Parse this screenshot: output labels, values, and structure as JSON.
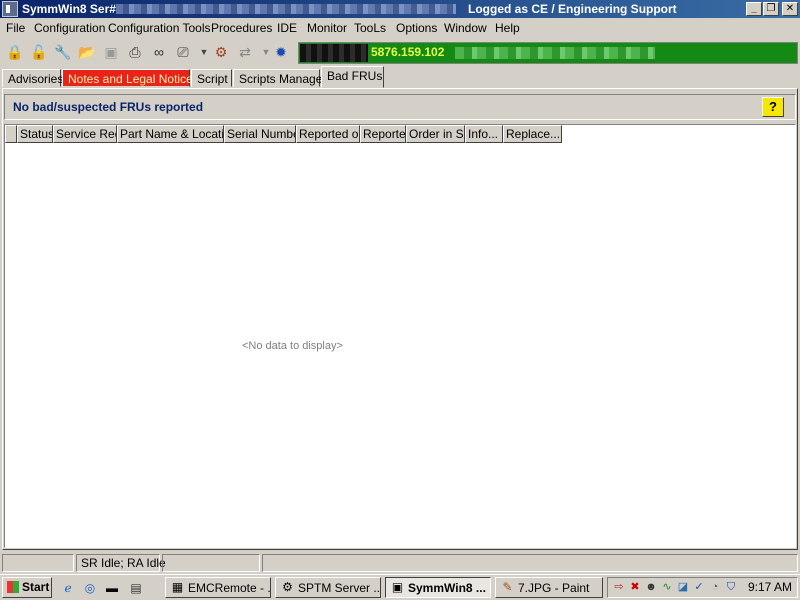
{
  "window": {
    "title": "SymmWin8 Ser#",
    "status": "Logged as CE / Engineering Support",
    "controls": {
      "minimize": "_",
      "restore": "❐",
      "close": "✕"
    }
  },
  "menu": [
    "File",
    "Configuration",
    "Configuration Tools",
    "Procedures",
    "IDE",
    "Monitor",
    "TooLs",
    "Options",
    "Window",
    "Help"
  ],
  "toolbar": {
    "icons": [
      "lock-icon",
      "lock-open-icon",
      "wrench-icon",
      "folder-open-icon",
      "save-icon",
      "print-icon",
      "binoculars-icon",
      "printer-setup-icon",
      "dropdown-arrow-icon",
      "plugin-icon",
      "connect-icon",
      "dropdown-arrow-icon",
      "gear-icon"
    ],
    "host_ip": "5876.159.102"
  },
  "tabs": [
    {
      "label": "Advisories",
      "style": "normal"
    },
    {
      "label": "Notes and Legal Notices",
      "style": "red"
    },
    {
      "label": "Script",
      "style": "normal"
    },
    {
      "label": "Scripts Manager",
      "style": "normal"
    },
    {
      "label": "Bad FRUs",
      "style": "active"
    }
  ],
  "panel": {
    "header": "No bad/suspected FRUs reported",
    "help_label": "?"
  },
  "grid": {
    "columns": [
      "Status",
      "Service Req",
      "Part Name & Location",
      "Serial Number",
      "Reported on",
      "Reporter",
      "Order in SR",
      "Info...",
      "Replace..."
    ],
    "empty_message": "<No data to display>"
  },
  "statusbar": {
    "panes": [
      "",
      "SR Idle; RA Idle",
      "",
      ""
    ]
  },
  "taskbar": {
    "start_label": "Start",
    "tasks": [
      {
        "label": "EMCRemote - ...",
        "active": false
      },
      {
        "label": "SPTM Server ...",
        "active": false
      },
      {
        "label": "SymmWin8 ...",
        "active": true
      },
      {
        "label": "7.JPG - Paint",
        "active": false
      }
    ],
    "clock": "9:17 AM"
  },
  "colors": {
    "title_bar": "#0a246a",
    "host_box": "#148a14",
    "host_ip_text": "#e6ff4a",
    "red_tab": "#e8231c",
    "header_text": "#0a246a",
    "help_button": "#f5e700"
  }
}
